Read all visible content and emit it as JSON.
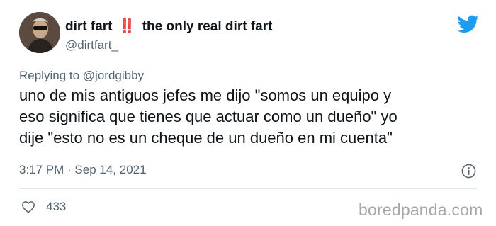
{
  "author": {
    "name": "dirt fart",
    "emoji": "‼️",
    "name_suffix": "the only real dirt fart",
    "handle": "@dirtfart_"
  },
  "reply": {
    "prefix": "Replying to",
    "mention": "@jordgibby"
  },
  "tweet": {
    "text": "uno de mis antiguos jefes me dijo \"somos un equipo y\neso significa que tienes que actuar como un dueño\" yo\ndije \"esto no es un cheque de un dueño en mi cuenta\"",
    "timestamp": "3:17 PM · Sep 14, 2021"
  },
  "engagement": {
    "likes": "433"
  },
  "watermark": "boredpanda.com",
  "colors": {
    "twitter_blue": "#1d9bf0",
    "secondary_text": "#536471",
    "emoji_red": "#e0245e"
  },
  "icons": {
    "logo": "twitter-bird-icon",
    "info": "info-icon",
    "like": "heart-outline-icon"
  }
}
